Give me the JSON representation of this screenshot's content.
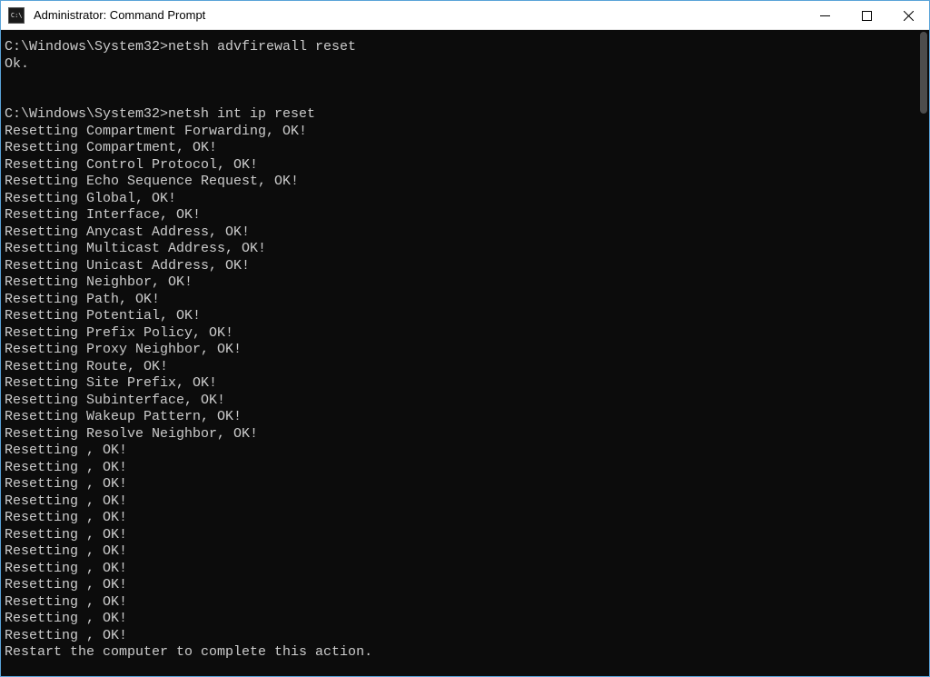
{
  "window": {
    "title": "Administrator: Command Prompt"
  },
  "terminal": {
    "lines": [
      "C:\\Windows\\System32>netsh advfirewall reset",
      "Ok.",
      "",
      "",
      "C:\\Windows\\System32>netsh int ip reset",
      "Resetting Compartment Forwarding, OK!",
      "Resetting Compartment, OK!",
      "Resetting Control Protocol, OK!",
      "Resetting Echo Sequence Request, OK!",
      "Resetting Global, OK!",
      "Resetting Interface, OK!",
      "Resetting Anycast Address, OK!",
      "Resetting Multicast Address, OK!",
      "Resetting Unicast Address, OK!",
      "Resetting Neighbor, OK!",
      "Resetting Path, OK!",
      "Resetting Potential, OK!",
      "Resetting Prefix Policy, OK!",
      "Resetting Proxy Neighbor, OK!",
      "Resetting Route, OK!",
      "Resetting Site Prefix, OK!",
      "Resetting Subinterface, OK!",
      "Resetting Wakeup Pattern, OK!",
      "Resetting Resolve Neighbor, OK!",
      "Resetting , OK!",
      "Resetting , OK!",
      "Resetting , OK!",
      "Resetting , OK!",
      "Resetting , OK!",
      "Resetting , OK!",
      "Resetting , OK!",
      "Resetting , OK!",
      "Resetting , OK!",
      "Resetting , OK!",
      "Resetting , OK!",
      "Resetting , OK!",
      "Restart the computer to complete this action."
    ]
  }
}
